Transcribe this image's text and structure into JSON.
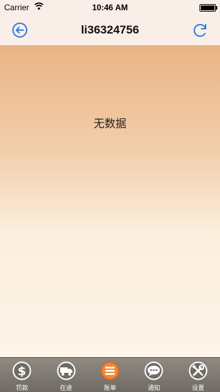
{
  "status_bar": {
    "carrier": "Carrier",
    "time": "10:46 AM"
  },
  "nav": {
    "title": "li36324756",
    "back_icon": "back-arrow-icon",
    "refresh_icon": "refresh-icon"
  },
  "content": {
    "empty_message": "无数据"
  },
  "tabs": [
    {
      "label": "罚款",
      "icon": "dollar-icon",
      "active": false
    },
    {
      "label": "在途",
      "icon": "truck-icon",
      "active": false
    },
    {
      "label": "账单",
      "icon": "list-icon",
      "active": true
    },
    {
      "label": "通知",
      "icon": "chat-icon",
      "active": false
    },
    {
      "label": "设置",
      "icon": "tools-icon",
      "active": false
    }
  ],
  "colors": {
    "accent": "#2f7fe0",
    "active_tab": "#e46a1b"
  }
}
